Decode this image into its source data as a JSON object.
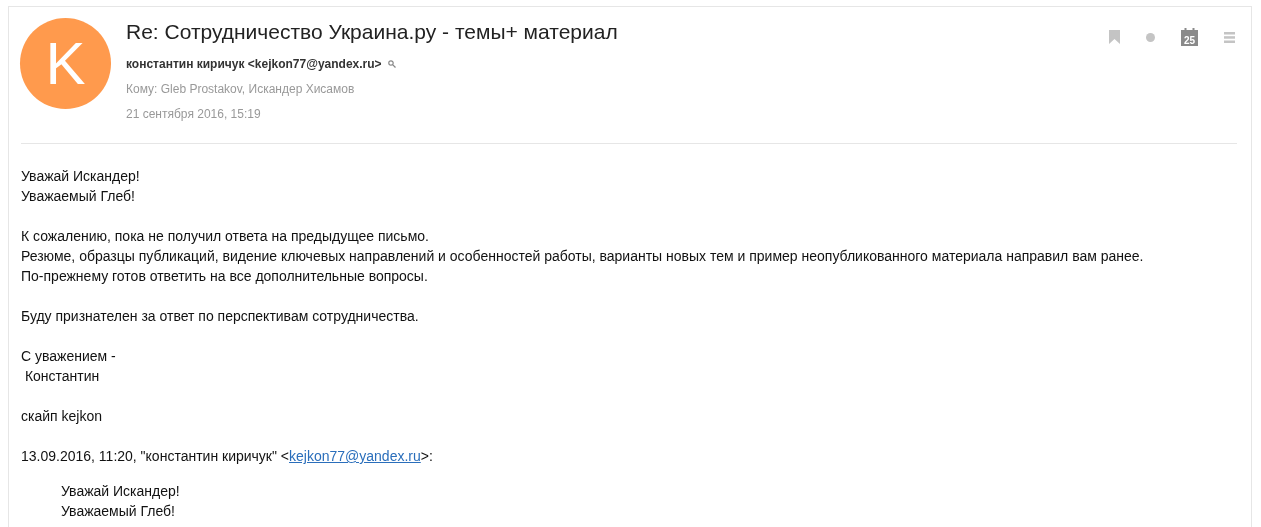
{
  "avatar": {
    "letter": "K",
    "color": "#ff9a4d"
  },
  "subject": "Re: Сотрудничество Украина.ру - темы+ материал",
  "sender": "константин киричук <kejkon77@yandex.ru>",
  "recipients": "Кому: Gleb Prostakov, Искандер Хисамов",
  "date": "21 сентября 2016, 15:19",
  "toolbar": {
    "calendar_day": "25"
  },
  "body": [
    [
      "Уважай Искандер!",
      "Уважаемый Глеб!"
    ],
    [
      "К сожалению, пока не получил ответа на предыдущее письмо.",
      "Резюме, образцы публикаций, видение ключевых направлений и особенностей работы, варианты новых тем и пример неопубликованного материала направил вам ранее.",
      "По-прежнему готов ответить на все дополнительные вопросы."
    ],
    [
      "Буду признателен за ответ по перспективам сотрудничества."
    ],
    [
      "С уважением -",
      " Константин"
    ],
    [
      "скайп kejkon"
    ]
  ],
  "quote_header": {
    "prefix": "13.09.2016, 11:20, \"константин киричук\" <",
    "link": "kejkon77@yandex.ru",
    "suffix": ">:"
  },
  "quote": [
    "Уважай Искандер!",
    "Уважаемый Глеб!"
  ]
}
